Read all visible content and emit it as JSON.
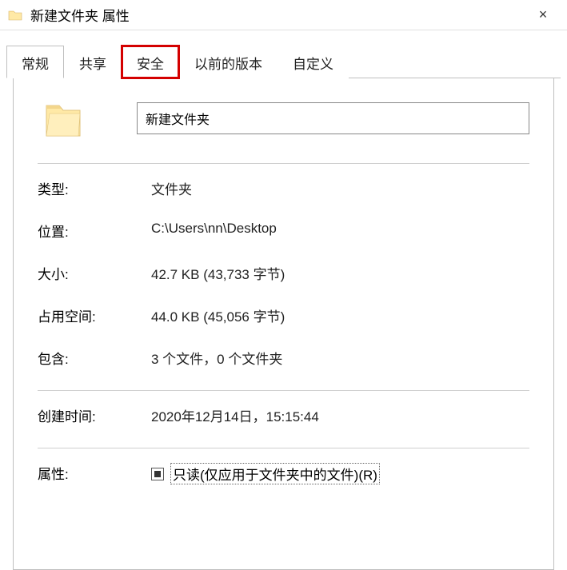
{
  "titlebar": {
    "title": "新建文件夹 属性",
    "close": "×"
  },
  "tabs": {
    "general": "常规",
    "sharing": "共享",
    "security": "安全",
    "previous_versions": "以前的版本",
    "customize": "自定义"
  },
  "name_field": {
    "value": "新建文件夹"
  },
  "props": {
    "type_label": "类型:",
    "type_value": "文件夹",
    "location_label": "位置:",
    "location_value": "C:\\Users\\nn\\Desktop",
    "size_label": "大小:",
    "size_value": "42.7 KB (43,733 字节)",
    "size_on_disk_label": "占用空间:",
    "size_on_disk_value": "44.0 KB (45,056 字节)",
    "contains_label": "包含:",
    "contains_value": "3 个文件，0 个文件夹",
    "created_label": "创建时间:",
    "created_value": "2020年12月14日，15:15:44",
    "attributes_label": "属性:",
    "readonly_label": "只读(仅应用于文件夹中的文件)(R)"
  }
}
